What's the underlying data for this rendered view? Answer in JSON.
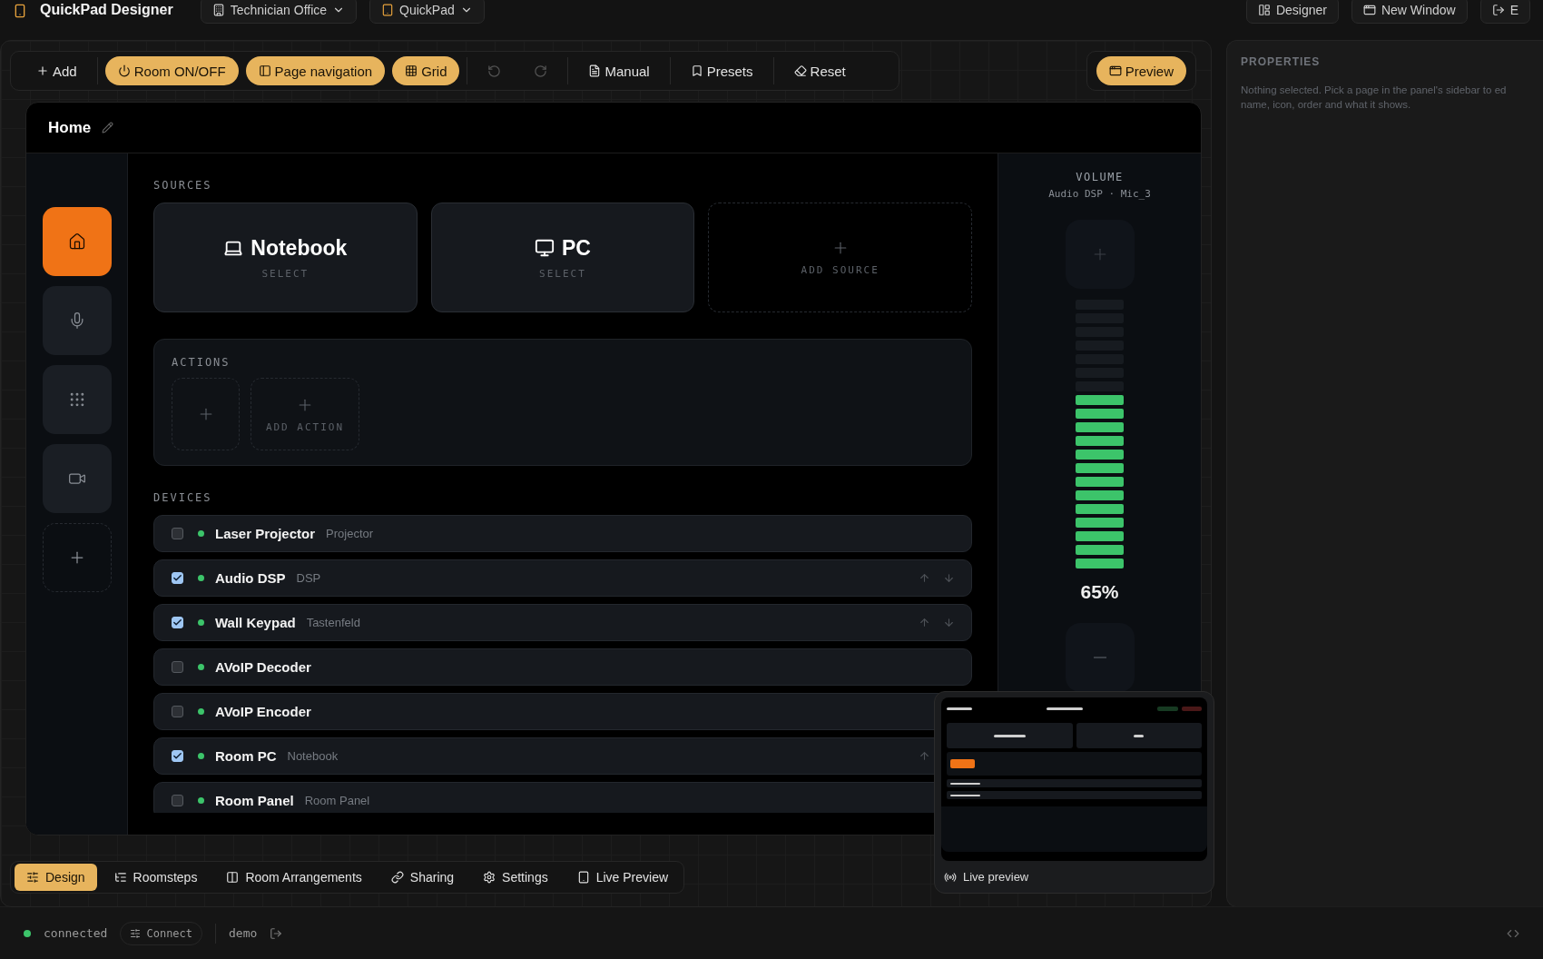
{
  "app": {
    "title": "QuickPad Designer",
    "room": "Technician Office",
    "panel": "QuickPad",
    "actions": [
      {
        "label": "Designer"
      },
      {
        "label": "New Window"
      },
      {
        "label": "E"
      }
    ]
  },
  "toolbar": {
    "groups": [
      {
        "items": [
          {
            "kind": "button",
            "label": "Add",
            "highlighted": false,
            "disabled": false
          }
        ]
      },
      {
        "items": [
          {
            "kind": "button",
            "label": "Room ON/OFF",
            "highlighted": true,
            "disabled": false
          },
          {
            "kind": "button",
            "label": "Page navigation",
            "highlighted": true,
            "disabled": false
          },
          {
            "kind": "button",
            "label": "Grid",
            "highlighted": true,
            "disabled": false
          }
        ]
      },
      {
        "items": [
          {
            "kind": "icon",
            "highlighted": false,
            "disabled": true
          },
          {
            "kind": "icon",
            "highlighted": false,
            "disabled": true
          }
        ]
      },
      {
        "items": [
          {
            "kind": "button",
            "label": "Manual",
            "highlighted": false,
            "disabled": false
          }
        ]
      },
      {
        "items": [
          {
            "kind": "button",
            "label": "Presets",
            "highlighted": false,
            "disabled": false
          }
        ]
      },
      {
        "items": [
          {
            "kind": "button",
            "label": "Reset",
            "highlighted": false,
            "disabled": false
          }
        ]
      }
    ],
    "preview": {
      "label": "Preview",
      "highlighted": true
    }
  },
  "page": {
    "title": "Home",
    "nav": [
      {
        "kind": "page",
        "selected": true
      },
      {
        "kind": "page",
        "selected": false
      },
      {
        "kind": "page",
        "selected": false
      },
      {
        "kind": "page",
        "selected": false
      },
      {
        "kind": "add",
        "selected": false
      }
    ],
    "sources": {
      "title": "SOURCES",
      "items": [
        {
          "kind": "source",
          "name": "Notebook",
          "hint": "SELECT"
        },
        {
          "kind": "source",
          "name": "PC",
          "hint": "SELECT"
        },
        {
          "kind": "add",
          "label": "ADD SOURCE"
        }
      ]
    },
    "actions": {
      "title": "ACTIONS",
      "items": [
        {
          "kind": "add"
        },
        {
          "kind": "add",
          "label": "ADD ACTION"
        }
      ]
    },
    "devices": {
      "title": "DEVICES",
      "items": [
        {
          "name": "Laser Projector",
          "type": "Projector",
          "checked": false,
          "online": true,
          "move_up": false,
          "move_down": false
        },
        {
          "name": "Audio DSP",
          "type": "DSP",
          "checked": true,
          "online": true,
          "move_up": true,
          "move_down": true
        },
        {
          "name": "Wall Keypad",
          "type": "Tastenfeld",
          "checked": true,
          "online": true,
          "move_up": true,
          "move_down": true
        },
        {
          "name": "AVoIP Decoder",
          "checked": false,
          "online": true,
          "move_up": false,
          "move_down": false
        },
        {
          "name": "AVoIP Encoder",
          "checked": false,
          "online": true,
          "move_up": false,
          "move_down": false
        },
        {
          "name": "Room PC",
          "type": "Notebook",
          "checked": true,
          "online": true,
          "move_up": true,
          "move_down": false
        },
        {
          "name": "Room Panel",
          "type": "Room Panel",
          "checked": false,
          "online": true,
          "move_up": false,
          "move_down": false
        }
      ]
    },
    "volume": {
      "title": "VOLUME",
      "source": "Audio DSP · Mic_3",
      "level": 0.65,
      "reading": "65%"
    }
  },
  "live_preview": {
    "label": "Live preview"
  },
  "bottom_tabs": [
    {
      "label": "Design",
      "selected": true
    },
    {
      "label": "Roomsteps",
      "selected": false
    },
    {
      "label": "Room Arrangements",
      "selected": false
    },
    {
      "label": "Sharing",
      "selected": false
    },
    {
      "label": "Settings",
      "selected": false
    },
    {
      "label": "Live Preview",
      "selected": false
    }
  ],
  "properties": {
    "title": "PROPERTIES",
    "message": "Nothing selected. Pick a page in the panel's sidebar to ed\nname, icon, order and what it shows."
  },
  "status": {
    "connected": true,
    "connection": "connected",
    "connect_button": "Connect",
    "user": "demo"
  }
}
